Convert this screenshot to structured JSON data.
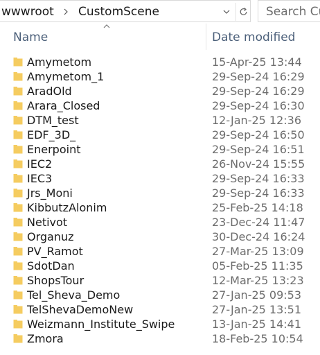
{
  "address_bar": {
    "breadcrumbs": [
      "wwwroot",
      "CustomScene"
    ]
  },
  "search": {
    "placeholder": "Search Cu"
  },
  "columns": {
    "name": "Name",
    "date_modified": "Date modified",
    "sort": "ascending"
  },
  "icons": {
    "folder": "folder-icon",
    "breadcrumb_separator": "chevron-right-icon",
    "address_dropdown": "chevron-down-icon",
    "refresh": "refresh-icon",
    "sort": "sort-up-icon"
  },
  "colors": {
    "folder": "#f5cc60",
    "header_text": "#4c607a",
    "date_text": "#6d6d6d"
  },
  "files": [
    {
      "name": "Amymetom",
      "date": "15-Apr-25 13:44"
    },
    {
      "name": "Amymetom_1",
      "date": "29-Sep-24 16:29"
    },
    {
      "name": "AradOld",
      "date": "29-Sep-24 16:29"
    },
    {
      "name": "Arara_Closed",
      "date": "29-Sep-24 16:30"
    },
    {
      "name": "DTM_test",
      "date": "12-Jan-25 12:36"
    },
    {
      "name": "EDF_3D_",
      "date": "29-Sep-24 16:50"
    },
    {
      "name": "Enerpoint",
      "date": "29-Sep-24 16:51"
    },
    {
      "name": "IEC2",
      "date": "26-Nov-24 15:55"
    },
    {
      "name": "IEC3",
      "date": "29-Sep-24 16:33"
    },
    {
      "name": "Jrs_Moni",
      "date": "29-Sep-24 16:33"
    },
    {
      "name": "KibbutzAlonim",
      "date": "25-Feb-25 14:18"
    },
    {
      "name": "Netivot",
      "date": "23-Dec-24 11:47"
    },
    {
      "name": "Organuz",
      "date": "30-Dec-24 16:24"
    },
    {
      "name": "PV_Ramot",
      "date": "27-Mar-25 13:09"
    },
    {
      "name": "SdotDan",
      "date": "05-Feb-25 11:35"
    },
    {
      "name": "ShopsTour",
      "date": "12-Mar-25 13:23"
    },
    {
      "name": "Tel_Sheva_Demo",
      "date": "27-Jan-25 09:53"
    },
    {
      "name": "TelShevaDemoNew",
      "date": "27-Jan-25 13:51"
    },
    {
      "name": "Weizmann_Institute_Swipe",
      "date": "13-Jan-25 14:41"
    },
    {
      "name": "Zmora",
      "date": "18-Feb-25 10:54"
    }
  ]
}
